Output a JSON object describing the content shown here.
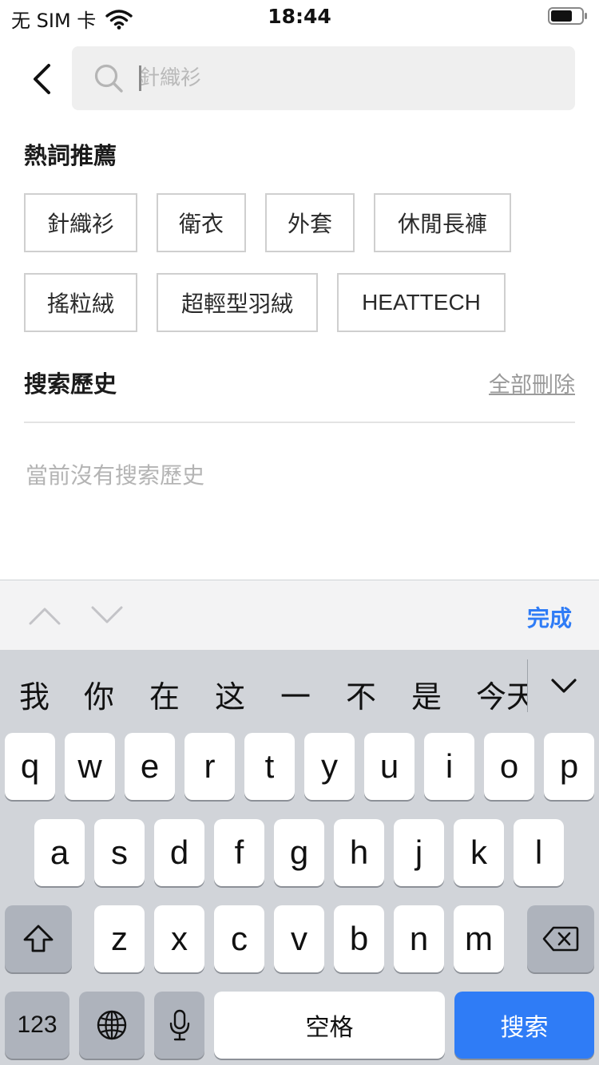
{
  "status_bar": {
    "carrier": "无 SIM 卡",
    "time": "18:44"
  },
  "search": {
    "placeholder": "針織衫",
    "back_icon": "chevron-left-icon",
    "search_icon": "search-icon"
  },
  "hot_words": {
    "title": "熱詞推薦",
    "tags": [
      "針織衫",
      "衛衣",
      "外套",
      "休閒長褲",
      "搖粒絨",
      "超輕型羽絨",
      "HEATTECH"
    ]
  },
  "history": {
    "title": "搜索歷史",
    "clear_label": "全部刪除",
    "empty_text": "當前沒有搜索歷史"
  },
  "accessory": {
    "done_label": "完成",
    "up_icon": "chevron-up-icon",
    "down_icon": "chevron-down-icon"
  },
  "keyboard": {
    "candidates": [
      "我",
      "你",
      "在",
      "这",
      "一",
      "不",
      "是",
      "今天"
    ],
    "row1": [
      "q",
      "w",
      "e",
      "r",
      "t",
      "y",
      "u",
      "i",
      "o",
      "p"
    ],
    "row2": [
      "a",
      "s",
      "d",
      "f",
      "g",
      "h",
      "j",
      "k",
      "l"
    ],
    "row3": [
      "z",
      "x",
      "c",
      "v",
      "b",
      "n",
      "m"
    ],
    "numbers_label": "123",
    "space_label": "空格",
    "search_label": "搜索",
    "shift_icon": "shift-icon",
    "delete_icon": "backspace-icon",
    "globe_icon": "globe-icon",
    "mic_icon": "microphone-icon"
  }
}
